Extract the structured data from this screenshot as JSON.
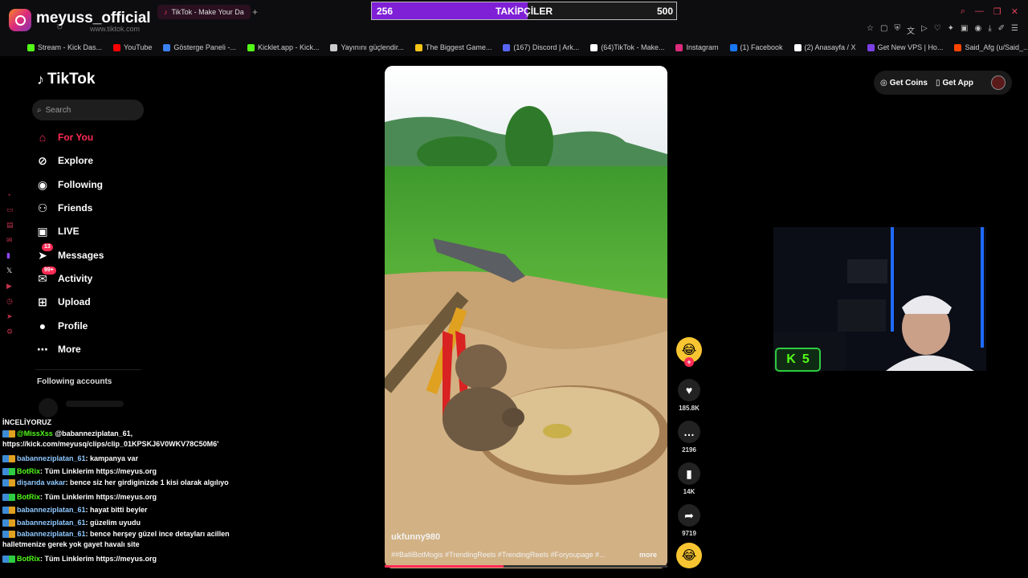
{
  "browser": {
    "brand_name": "meyuss_official",
    "tab_title": "TikTok - Make Your Da",
    "url": "www.tiktok.com",
    "bookmarks": [
      {
        "label": "Stream - Kick Das...",
        "color": "#53fc18"
      },
      {
        "label": "YouTube",
        "color": "#ff0000"
      },
      {
        "label": "Gösterge Paneli -...",
        "color": "#3b82f6"
      },
      {
        "label": "Kicklet.app - Kick...",
        "color": "#53fc18"
      },
      {
        "label": "Yayınını güçlendir...",
        "color": "#cccccc"
      },
      {
        "label": "The Biggest Game...",
        "color": "#f5c518"
      },
      {
        "label": "(167) Discord | Ark...",
        "color": "#5865f2"
      },
      {
        "label": "(64)TikTok - Make...",
        "color": "#ffffff"
      },
      {
        "label": "Instagram",
        "color": "#dd2a7b"
      },
      {
        "label": "(1) Facebook",
        "color": "#1877f2"
      },
      {
        "label": "(2) Anasayfa / X",
        "color": "#ffffff"
      },
      {
        "label": "Get New VPS | Ho...",
        "color": "#7b3fe4"
      },
      {
        "label": "Said_Afg (u/Said_...",
        "color": "#ff4500"
      }
    ]
  },
  "followers_goal": {
    "current": "256",
    "label": "TAKİPÇİLER",
    "goal": "500",
    "progress": 0.512
  },
  "tiktok": {
    "logo_text": "TikTok",
    "search_placeholder": "Search",
    "nav": [
      {
        "label": "For You",
        "icon": "home-icon"
      },
      {
        "label": "Explore",
        "icon": "compass-icon"
      },
      {
        "label": "Following",
        "icon": "following-avatar-icon"
      },
      {
        "label": "Friends",
        "icon": "friends-icon"
      },
      {
        "label": "LIVE",
        "icon": "live-icon"
      },
      {
        "label": "Messages",
        "icon": "messages-icon",
        "badge": "13"
      },
      {
        "label": "Activity",
        "icon": "activity-icon",
        "badge": "99+"
      },
      {
        "label": "Upload",
        "icon": "upload-icon"
      },
      {
        "label": "Profile",
        "icon": "profile-icon"
      },
      {
        "label": "More",
        "icon": "more-icon"
      }
    ],
    "following_accounts_heading": "Following accounts",
    "get_coins": "Get Coins",
    "get_app": "Get App"
  },
  "video": {
    "author": "ukfunny980",
    "tags": "##BalliBotMogis #TrendingReels #TrendingReels #Foryoupage #...",
    "more": "more",
    "progress": 0.42,
    "likes": "185.8K",
    "comments": "2196",
    "saves": "14K",
    "shares": "9719"
  },
  "kick_counter": {
    "value": "5"
  },
  "chat": {
    "title": "İNCELİYORUZ",
    "messages": [
      {
        "user": "@MissXss",
        "text": " @babanneziplatan_61, https://kick.com/meyusq/clips/clip_01KPSKJ6V0WKV78C50M6'"
      },
      {
        "user": "babanneziplatan_61",
        "text": ": kampanya var"
      },
      {
        "user": "BotRix",
        "text": ": Tüm Linklerim https://meyus.org"
      },
      {
        "user": "dişarıda vakar",
        "text": ": bence siz her girdiginizde 1 kisi olarak algılıyo"
      },
      {
        "user": "BotRix",
        "text": ": Tüm Linklerim https://meyus.org"
      },
      {
        "user": "babanneziplatan_61",
        "text": ": hayat bitti beyler"
      },
      {
        "user": "babanneziplatan_61",
        "text": ": güzelim uyudu"
      },
      {
        "user": "babanneziplatan_61",
        "text": ": bence herşey güzel ince detayları acillen halletmenize gerek yok gayet havalı site"
      },
      {
        "user": "BotRix",
        "text": ": Tüm Linklerim https://meyus.org"
      }
    ]
  }
}
